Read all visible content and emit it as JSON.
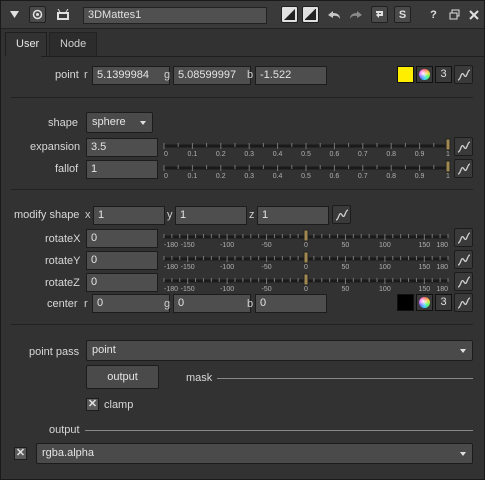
{
  "titlebar": {
    "node_name": "3DMattes1",
    "s_label": "S",
    "help_label": "?"
  },
  "tabs": [
    {
      "label": "User"
    },
    {
      "label": "Node"
    }
  ],
  "point": {
    "label": "point",
    "r_label": "r",
    "r_value": "5.1399984",
    "g_label": "g",
    "g_value": "5.08599997",
    "b_label": "b",
    "b_value": "-1.522",
    "channels": "3",
    "swatch_color": "#ffee00"
  },
  "shape": {
    "label": "shape",
    "value": "sphere"
  },
  "expansion": {
    "label": "expansion",
    "value": "3.5",
    "ticks": [
      "0",
      "0.1",
      "0.2",
      "0.3",
      "0.4",
      "0.5",
      "0.6",
      "0.7",
      "0.8",
      "0.9",
      "1"
    ],
    "slider_fraction": 1.0
  },
  "falloff": {
    "label": "fallof",
    "value": "1",
    "ticks": [
      "0",
      "0.1",
      "0.2",
      "0.3",
      "0.4",
      "0.5",
      "0.6",
      "0.7",
      "0.8",
      "0.9",
      "1"
    ],
    "slider_fraction": 1.0
  },
  "modify_shape": {
    "label": "modify shape",
    "x_label": "x",
    "x_value": "1",
    "y_label": "y",
    "y_value": "1",
    "z_label": "z",
    "z_value": "1"
  },
  "rotateX": {
    "label": "rotateX",
    "value": "0",
    "ticks": [
      "-180",
      "-150",
      "-100",
      "-50",
      "0",
      "50",
      "100",
      "150",
      "180"
    ],
    "slider_value": 0
  },
  "rotateY": {
    "label": "rotateY",
    "value": "0",
    "ticks": [
      "-180",
      "-150",
      "-100",
      "-50",
      "0",
      "50",
      "100",
      "150",
      "180"
    ],
    "slider_value": 0
  },
  "rotateZ": {
    "label": "rotateZ",
    "value": "0",
    "ticks": [
      "-180",
      "-150",
      "-100",
      "-50",
      "0",
      "50",
      "100",
      "150",
      "180"
    ],
    "slider_value": 0
  },
  "center": {
    "label": "center",
    "r_label": "r",
    "r_value": "0",
    "g_label": "g",
    "g_value": "0",
    "b_label": "b",
    "b_value": "0",
    "channels": "3",
    "swatch_color": "#000000"
  },
  "point_pass": {
    "label": "point pass",
    "value": "point"
  },
  "output_button": {
    "label": "output"
  },
  "mask": {
    "label": "mask"
  },
  "clamp": {
    "label": "clamp",
    "checked": true
  },
  "output_section": {
    "label": "output",
    "value": "rgba.alpha",
    "enabled": true
  },
  "colors": {
    "panel_bg": "#323232",
    "field_bg": "#4e4e4e",
    "slider_handle": "#a08850"
  }
}
